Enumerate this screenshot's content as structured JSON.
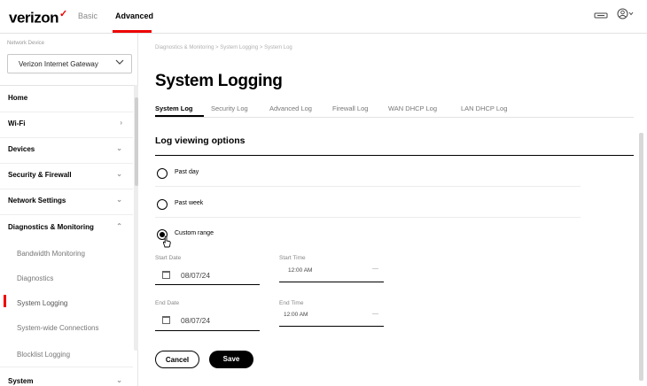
{
  "header": {
    "logo": "verizon",
    "logo_mark": "✓",
    "nav_basic": "Basic",
    "nav_advanced": "Advanced",
    "icons": [
      "network-status-icon",
      "user-account-icon"
    ]
  },
  "sidebar": {
    "device_label": "Network Device",
    "device_value": "Verizon Internet Gateway",
    "items": [
      {
        "label": "Home"
      },
      {
        "label": "Wi-Fi"
      },
      {
        "label": "Devices"
      },
      {
        "label": "Security & Firewall"
      },
      {
        "label": "Network Settings"
      },
      {
        "label": "Diagnostics & Monitoring"
      },
      {
        "label": "Bandwidth Monitoring"
      },
      {
        "label": "Diagnostics"
      },
      {
        "label": "System Logging"
      },
      {
        "label": "System-wide Connections"
      },
      {
        "label": "Blocklist Logging"
      },
      {
        "label": "System"
      }
    ]
  },
  "main": {
    "breadcrumb": "Diagnostics & Monitoring > System Logging > System Log",
    "title": "System Logging",
    "tabs": [
      "System Log",
      "Security Log",
      "Advanced Log",
      "Firewall Log",
      "WAN DHCP Log",
      "LAN DHCP Log"
    ],
    "section_title": "Log viewing options",
    "options": [
      "Past day",
      "Past week",
      "Custom range"
    ],
    "selected_option": "Custom range",
    "start_date_label": "Start Date",
    "start_date_value": "08/07/24",
    "start_time_label": "Start Time",
    "start_time_value": "12:00 AM",
    "end_date_label": "End Date",
    "end_date_value": "08/07/24",
    "end_time_label": "End Time",
    "end_time_value": "12:00 AM",
    "cancel_label": "Cancel",
    "save_label": "Save"
  },
  "colors": {
    "brand_red": "#ee0000",
    "text": "#000000",
    "muted": "#777777"
  }
}
